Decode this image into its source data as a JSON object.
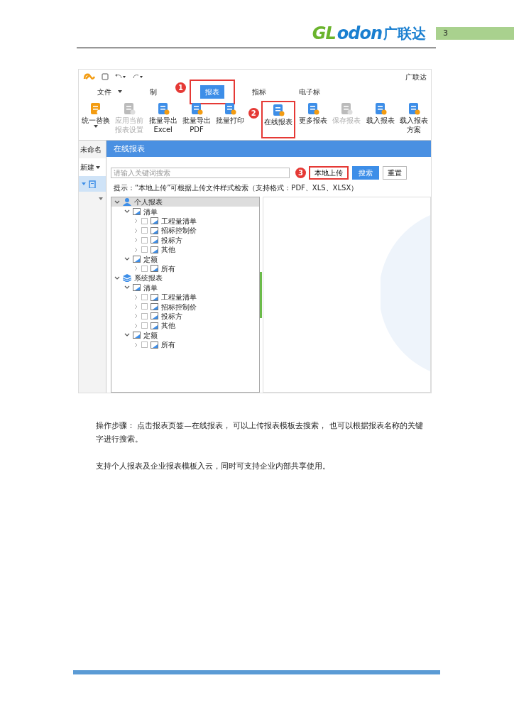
{
  "header": {
    "logo_parts": [
      "GL",
      "odon",
      "广联达"
    ],
    "page_number": "3"
  },
  "app": {
    "title_right": "广联达",
    "tabs": [
      {
        "label": "文件",
        "dropdown": true,
        "selected": false,
        "highlighted": false
      },
      {
        "label": "制",
        "dropdown": false,
        "selected": false,
        "highlighted": false
      },
      {
        "label": "报表",
        "dropdown": false,
        "selected": true,
        "highlighted": true,
        "marker": "1"
      },
      {
        "label": "指标",
        "dropdown": false,
        "selected": false,
        "highlighted": false
      },
      {
        "label": "电子标",
        "dropdown": false,
        "selected": false,
        "highlighted": false
      }
    ],
    "ribbon": [
      {
        "kind": "replace",
        "lines": [
          "统一替换"
        ],
        "dropdown": true,
        "disabled": false,
        "highlighted": false
      },
      {
        "kind": "settings",
        "lines": [
          "应用当前",
          "报表设置"
        ],
        "dropdown": false,
        "disabled": true,
        "highlighted": false
      },
      {
        "kind": "export",
        "lines": [
          "批量导出",
          "Excel"
        ],
        "dropdown": false,
        "disabled": false,
        "highlighted": false
      },
      {
        "kind": "pdf",
        "lines": [
          "批量导出",
          "PDF"
        ],
        "dropdown": false,
        "disabled": false,
        "highlighted": false
      },
      {
        "kind": "print",
        "lines": [
          "批量打印"
        ],
        "dropdown": false,
        "disabled": false,
        "highlighted": false
      },
      {
        "kind": "online",
        "lines": [
          "在线报表"
        ],
        "dropdown": false,
        "disabled": false,
        "highlighted": true,
        "marker": "2"
      },
      {
        "kind": "more",
        "lines": [
          "更多报表"
        ],
        "dropdown": false,
        "disabled": false,
        "highlighted": false
      },
      {
        "kind": "save",
        "lines": [
          "保存报表"
        ],
        "dropdown": false,
        "disabled": true,
        "highlighted": false
      },
      {
        "kind": "load",
        "lines": [
          "载入报表"
        ],
        "dropdown": false,
        "disabled": false,
        "highlighted": false
      },
      {
        "kind": "load",
        "lines": [
          "载入报表",
          "方案"
        ],
        "dropdown": false,
        "disabled": false,
        "highlighted": false
      }
    ],
    "left_panel": {
      "doc_tab": "未命名",
      "new_button": {
        "label": "新建",
        "dropdown": true
      }
    },
    "dialog": {
      "title": "在线报表",
      "search": {
        "placeholder": "请输入关键词搜索"
      },
      "buttons": [
        {
          "label": "本地上传",
          "kind": "outline",
          "highlighted": true,
          "marker": "3"
        },
        {
          "label": "搜索",
          "kind": "primary",
          "highlighted": false
        },
        {
          "label": "重置",
          "kind": "outline",
          "highlighted": false
        }
      ],
      "hint": "提示：“本地上传”可根据上传文件样式检索（支持格式：PDF、XLS、XLSX）",
      "tree": [
        {
          "label": "个人报表",
          "kind": "person",
          "expanded": true,
          "selected": true,
          "children": [
            {
              "label": "清单",
              "kind": "folder",
              "expanded": true,
              "selected": false,
              "children": [
                {
                  "label": "工程量清单",
                  "kind": "folder",
                  "expanded": false,
                  "checked": false,
                  "selected": false
                },
                {
                  "label": "招标控制价",
                  "kind": "folder",
                  "expanded": false,
                  "checked": false,
                  "selected": false
                },
                {
                  "label": "投标方",
                  "kind": "folder",
                  "expanded": false,
                  "checked": false,
                  "selected": false
                },
                {
                  "label": "其他",
                  "kind": "folder",
                  "expanded": false,
                  "checked": false,
                  "selected": false
                }
              ]
            },
            {
              "label": "定额",
              "kind": "folder",
              "expanded": true,
              "selected": false,
              "children": [
                {
                  "label": "所有",
                  "kind": "folder",
                  "expanded": false,
                  "checked": false,
                  "selected": false
                }
              ]
            }
          ]
        },
        {
          "label": "系统报表",
          "kind": "layers",
          "expanded": true,
          "selected": false,
          "children": [
            {
              "label": "清单",
              "kind": "folder",
              "expanded": true,
              "selected": false,
              "children": [
                {
                  "label": "工程量清单",
                  "kind": "folder",
                  "expanded": false,
                  "checked": false,
                  "selected": false
                },
                {
                  "label": "招标控制价",
                  "kind": "folder",
                  "expanded": false,
                  "checked": false,
                  "selected": false
                },
                {
                  "label": "投标方",
                  "kind": "folder",
                  "expanded": false,
                  "checked": false,
                  "selected": false
                },
                {
                  "label": "其他",
                  "kind": "folder",
                  "expanded": false,
                  "checked": false,
                  "selected": false
                }
              ]
            },
            {
              "label": "定额",
              "kind": "folder",
              "expanded": true,
              "selected": false,
              "children": [
                {
                  "label": "所有",
                  "kind": "folder",
                  "expanded": false,
                  "checked": false,
                  "selected": false
                }
              ]
            }
          ]
        }
      ]
    }
  },
  "notes": [
    "操作步骤： 点击报表页签—在线报表， 可以上传报表模板去搜索， 也可以根据报表名称的关键字进行搜索。",
    "支持个人报表及企业报表模板入云，同时可支持企业内部共享使用。"
  ]
}
